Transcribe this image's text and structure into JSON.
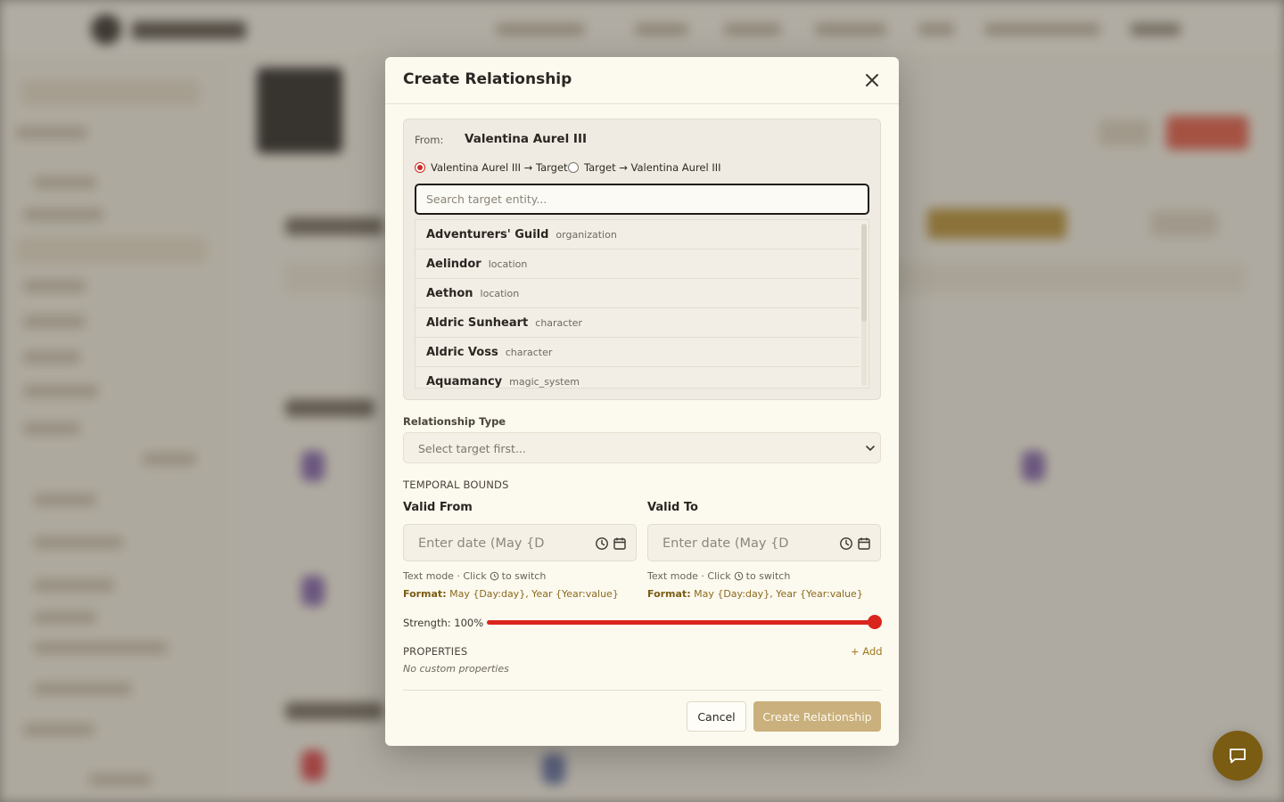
{
  "modal": {
    "title": "Create Relationship",
    "close_icon": "close-icon"
  },
  "from": {
    "label": "From:",
    "entity": "Valentina Aurel III",
    "direction_options": [
      {
        "label": "Valentina Aurel III → Target",
        "checked": true
      },
      {
        "label": "Target → Valentina Aurel III",
        "checked": false
      }
    ]
  },
  "search": {
    "placeholder": "Search target entity...",
    "value": ""
  },
  "entities": [
    {
      "name": "Adventurers' Guild",
      "type": "organization"
    },
    {
      "name": "Aelindor",
      "type": "location"
    },
    {
      "name": "Aethon",
      "type": "location"
    },
    {
      "name": "Aldric Sunheart",
      "type": "character"
    },
    {
      "name": "Aldric Voss",
      "type": "character"
    },
    {
      "name": "Aquamancy",
      "type": "magic_system"
    }
  ],
  "relationship_type": {
    "label": "Relationship Type",
    "placeholder": "Select target first..."
  },
  "temporal": {
    "heading": "TEMPORAL BOUNDS",
    "valid_from": {
      "label": "Valid From",
      "placeholder": "Enter date (May {D",
      "hint_prefix": "Text mode · Click",
      "hint_suffix": "to switch",
      "format_label": "Format:",
      "format_value": "May {Day:day}, Year {Year:value}"
    },
    "valid_to": {
      "label": "Valid To",
      "placeholder": "Enter date (May {D",
      "hint_prefix": "Text mode · Click",
      "hint_suffix": "to switch",
      "format_label": "Format:",
      "format_value": "May {Day:day}, Year {Year:value}"
    }
  },
  "strength": {
    "label": "Strength: 100%",
    "value": 1.0
  },
  "properties": {
    "heading": "PROPERTIES",
    "add_label": "+ Add",
    "empty_text": "No custom properties"
  },
  "footer": {
    "cancel_label": "Cancel",
    "create_label": "Create Relationship"
  },
  "colors": {
    "accent": "#d9251d",
    "gold": "#c9b07c",
    "fab": "#7a5c12"
  }
}
